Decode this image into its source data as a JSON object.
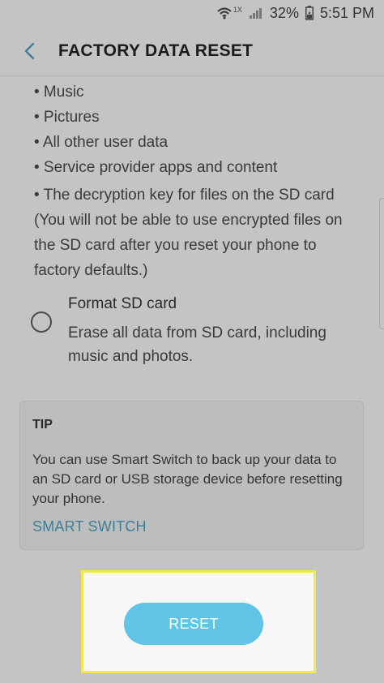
{
  "status_bar": {
    "network_badge": "1X",
    "battery_percent": "32%",
    "time": "5:51 PM",
    "icons": [
      "wifi-icon",
      "signal-icon",
      "battery-icon"
    ]
  },
  "header": {
    "title": "FACTORY DATA RESET",
    "back_icon": "chevron-left-icon"
  },
  "data_list": [
    "• Music",
    "• Pictures",
    "• All other user data",
    "• Service provider apps and content"
  ],
  "sd_card_note": "• The decryption key for files on the SD card (You will not be able to use encrypted files on the SD card after you reset your phone to factory defaults.)",
  "format_option": {
    "title": "Format SD card",
    "description": "Erase all data from SD card, including music and photos.",
    "checked": false
  },
  "tip": {
    "label": "TIP",
    "body": "You can use Smart Switch to back up your data to an SD card or USB storage device before resetting your phone.",
    "link": "SMART SWITCH"
  },
  "reset_button": {
    "label": "RESET"
  },
  "colors": {
    "accent": "#3d7f97",
    "reset_button": "#5fc4e6",
    "highlight_border": "#f2ea4a",
    "background": "#c4c4c4"
  }
}
